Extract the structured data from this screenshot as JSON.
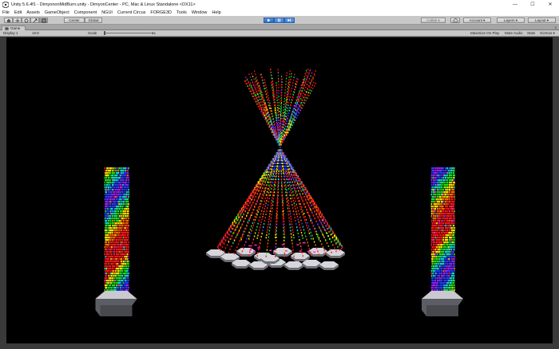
{
  "window": {
    "title": "Unity 5.6.4f1 - DimyononMidBurn.unity - DimyonCenter - PC, Mac & Linux Standalone <DX11>",
    "controls": {
      "minimize": "—",
      "maximize": "☐",
      "close": "✕"
    }
  },
  "menu": [
    "File",
    "Edit",
    "Assets",
    "GameObject",
    "Component",
    "NGUI",
    "Current Circus",
    "FORGE3D",
    "Tools",
    "Window",
    "Help"
  ],
  "toolbar": {
    "pivot_label": "Center",
    "space_label": "Global",
    "collab_label": "Collab ▾",
    "account_label": "Account ▾",
    "layers_label": "Layers ▾",
    "layout_label": "Layout ▾"
  },
  "game_tab": {
    "label": "Game",
    "menu": "≡"
  },
  "game_bar": {
    "display": "Display 1",
    "aspect": "16:9",
    "scale_label": "Scale",
    "scale_value": "1x",
    "maximize_on_play": "Maximize On Play",
    "mute_audio": "Mute Audio",
    "stats": "Stats",
    "gizmos": "Gizmos ▾"
  },
  "colors": {
    "viewport_bg": "#000000",
    "led_palette": [
      "#ff1a1a",
      "#ff6a00",
      "#ffe600",
      "#22e01e",
      "#18d6c8",
      "#2a3cff",
      "#9a22ff",
      "#ff2ad0"
    ]
  },
  "icons": [
    "unity-logo-icon",
    "hand-tool-icon",
    "move-tool-icon",
    "rotate-tool-icon",
    "scale-tool-icon",
    "rect-tool-icon",
    "play-icon",
    "pause-icon",
    "step-icon",
    "cloud-icon",
    "game-tab-icon"
  ]
}
